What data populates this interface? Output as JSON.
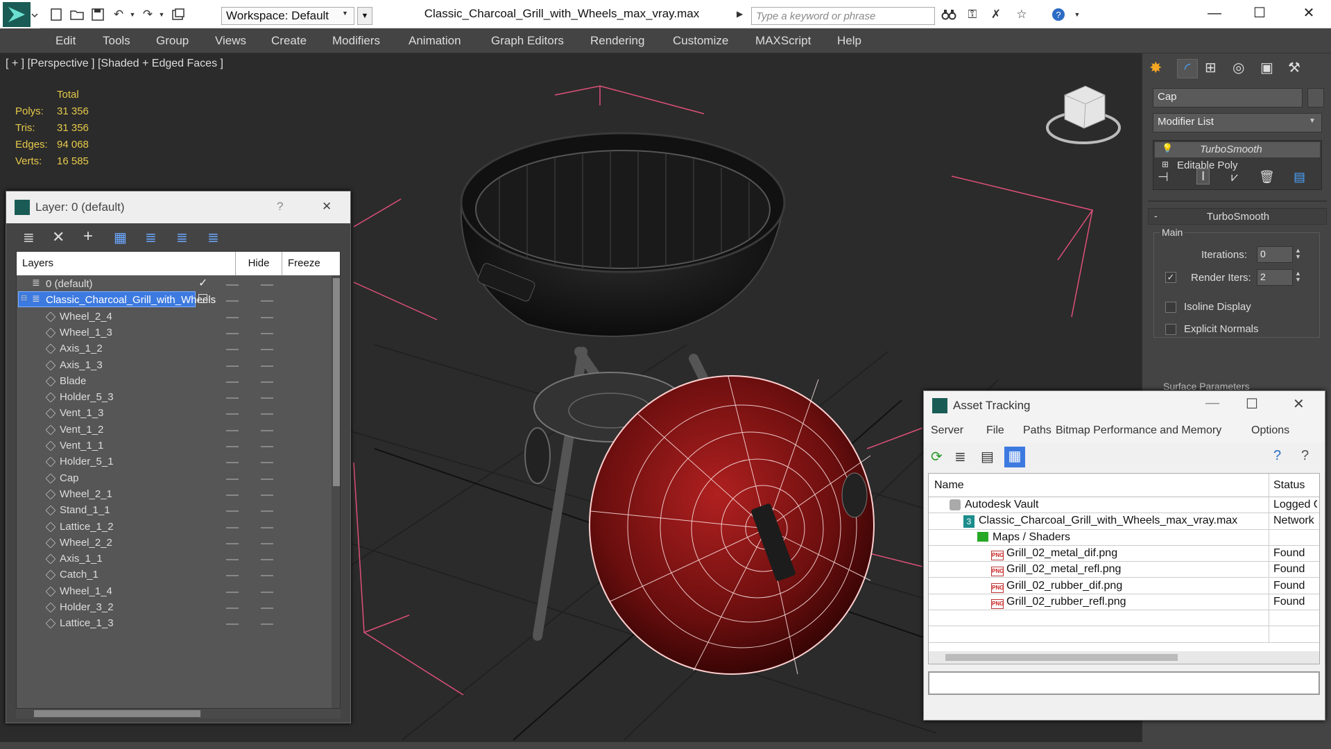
{
  "window": {
    "title": "Classic_Charcoal_Grill_with_Wheels_max_vray.max",
    "workspace": "Workspace: Default",
    "search_placeholder": "Type a keyword or phrase"
  },
  "menu": [
    "Edit",
    "Tools",
    "Group",
    "Views",
    "Create",
    "Modifiers",
    "Animation",
    "Graph Editors",
    "Rendering",
    "Customize",
    "MAXScript",
    "Help"
  ],
  "viewport": {
    "label": "[ + ] [Perspective ] [Shaded + Edged Faces ]",
    "stats_header": "Total",
    "stats": [
      {
        "label": "Polys:",
        "value": "31 356"
      },
      {
        "label": "Tris:",
        "value": "31 356"
      },
      {
        "label": "Edges:",
        "value": "94 068"
      },
      {
        "label": "Verts:",
        "value": "16 585"
      }
    ]
  },
  "command_panel": {
    "object_name": "Cap",
    "modifier_list": "Modifier List",
    "stack": [
      "TurboSmooth",
      "Editable Poly"
    ],
    "rollout_title": "TurboSmooth",
    "main_group": "Main",
    "iterations_label": "Iterations:",
    "iterations_value": "0",
    "render_iters_label": "Render Iters:",
    "render_iters_value": "2",
    "isoline_label": "Isoline Display",
    "explicit_label": "Explicit Normals",
    "surface_label": "Surface Parameters",
    "collapse": "-"
  },
  "layer_window": {
    "title": "Layer: 0 (default)",
    "help": "?",
    "close": "✕",
    "columns": {
      "layers": "Layers",
      "hide": "Hide",
      "freeze": "Freeze"
    },
    "rows": [
      {
        "name": "0 (default)",
        "level": 0
      },
      {
        "name": "Classic_Charcoal_Grill_with_Wheels",
        "level": 0
      },
      {
        "name": "Wheel_2_4",
        "level": 1
      },
      {
        "name": "Wheel_1_3",
        "level": 1
      },
      {
        "name": "Axis_1_2",
        "level": 1
      },
      {
        "name": "Axis_1_3",
        "level": 1
      },
      {
        "name": "Blade",
        "level": 1
      },
      {
        "name": "Holder_5_3",
        "level": 1
      },
      {
        "name": "Vent_1_3",
        "level": 1
      },
      {
        "name": "Vent_1_2",
        "level": 1
      },
      {
        "name": "Vent_1_1",
        "level": 1
      },
      {
        "name": "Holder_5_1",
        "level": 1
      },
      {
        "name": "Cap",
        "level": 1
      },
      {
        "name": "Wheel_2_1",
        "level": 1
      },
      {
        "name": "Stand_1_1",
        "level": 1
      },
      {
        "name": "Lattice_1_2",
        "level": 1
      },
      {
        "name": "Wheel_2_2",
        "level": 1
      },
      {
        "name": "Axis_1_1",
        "level": 1
      },
      {
        "name": "Catch_1",
        "level": 1
      },
      {
        "name": "Wheel_1_4",
        "level": 1
      },
      {
        "name": "Holder_3_2",
        "level": 1
      },
      {
        "name": "Lattice_1_3",
        "level": 1
      }
    ]
  },
  "asset_window": {
    "title": "Asset Tracking",
    "menu": [
      "Server",
      "File",
      "Paths",
      "Bitmap Performance and Memory",
      "Options"
    ],
    "col_name": "Name",
    "col_status": "Status",
    "rows": [
      {
        "name": "Autodesk Vault",
        "status": "Logged O",
        "indent": 0,
        "icon": "vault"
      },
      {
        "name": "Classic_Charcoal_Grill_with_Wheels_max_vray.max",
        "status": "Network F",
        "indent": 1,
        "icon": "max"
      },
      {
        "name": "Maps / Shaders",
        "status": "",
        "indent": 2,
        "icon": "maps"
      },
      {
        "name": "Grill_02_metal_dif.png",
        "status": "Found",
        "indent": 3,
        "icon": "png"
      },
      {
        "name": "Grill_02_metal_refl.png",
        "status": "Found",
        "indent": 3,
        "icon": "png"
      },
      {
        "name": "Grill_02_rubber_dif.png",
        "status": "Found",
        "indent": 3,
        "icon": "png"
      },
      {
        "name": "Grill_02_rubber_refl.png",
        "status": "Found",
        "indent": 3,
        "icon": "png"
      }
    ]
  },
  "colors": {
    "accent": "#3d7ae0",
    "selection": "#3d7ae0",
    "stat_yellow": "#e6c94a",
    "cap_red": "#7a1010",
    "bbox_pink": "#e0507a"
  }
}
